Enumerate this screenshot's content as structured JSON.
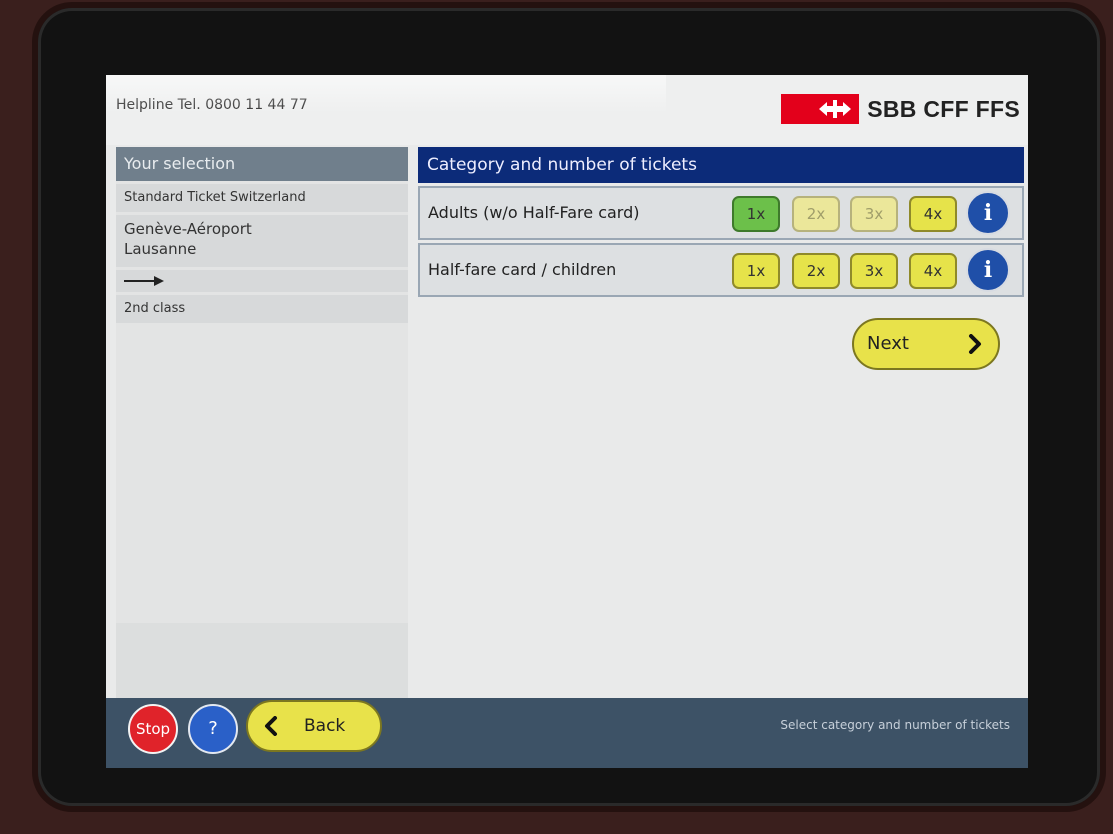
{
  "header": {
    "helpline": "Helpline  Tel. 0800 11 44 77",
    "brand": "SBB CFF FFS"
  },
  "selection": {
    "title": "Your selection",
    "ticket_type": "Standard Ticket Switzerland",
    "from": "Genève-Aéroport",
    "to": "Lausanne",
    "travel_class": "2nd class"
  },
  "main": {
    "title": "Category and number of tickets",
    "categories": [
      {
        "label": "Adults (w/o Half-Fare card)",
        "options": [
          "1x",
          "2x",
          "3x",
          "4x"
        ],
        "selected": "1x"
      },
      {
        "label": "Half-fare card / children",
        "options": [
          "1x",
          "2x",
          "3x",
          "4x"
        ],
        "selected": ""
      }
    ],
    "info_label": "i",
    "next_label": "Next"
  },
  "footer": {
    "stop_label": "Stop",
    "help_label": "?",
    "back_label": "Back",
    "status": "Select category and number of tickets"
  },
  "colors": {
    "brand_red": "#e3001b",
    "title_blue": "#0c2b79",
    "button_yellow": "#e6e34a",
    "selected_green": "#6cc04a",
    "footer_slate": "#3d5266"
  },
  "icons": [
    "sbb-logo-arrows-icon",
    "arrow-right-icon",
    "info-icon",
    "chevron-right-icon",
    "chevron-left-icon",
    "help-icon"
  ]
}
